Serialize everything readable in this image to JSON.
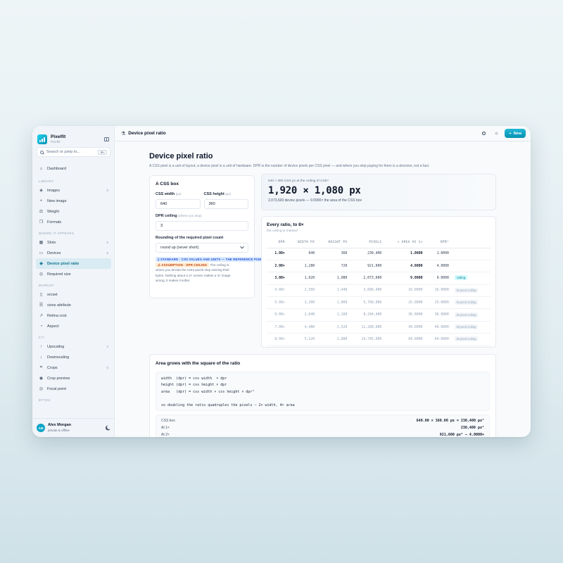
{
  "app": {
    "name": "Pixelfit",
    "subtitle": "Pixelfit"
  },
  "search": {
    "placeholder": "Search or jump to...",
    "shortcut": "⌘K"
  },
  "nav": {
    "dashboard": "Dashboard",
    "library_label": "LIBRARY",
    "library": [
      {
        "label": "Images",
        "count": "6"
      },
      {
        "label": "New image",
        "count": ""
      },
      {
        "label": "Weight",
        "count": ""
      },
      {
        "label": "Formats",
        "count": ""
      }
    ],
    "where_label": "WHERE IT APPEARS",
    "where": [
      {
        "label": "Slots",
        "count": "6"
      },
      {
        "label": "Devices",
        "count": "6"
      },
      {
        "label": "Device pixel ratio",
        "count": ""
      },
      {
        "label": "Required size",
        "count": ""
      }
    ],
    "markup_label": "MARKUP",
    "markup": [
      {
        "label": "srcset"
      },
      {
        "label": "sizes attribute"
      },
      {
        "label": "Retina cost"
      },
      {
        "label": "Aspect"
      }
    ],
    "fit_label": "FIT",
    "fit": [
      {
        "label": "Upscaling",
        "count": "2"
      },
      {
        "label": "Downscaling",
        "count": ""
      },
      {
        "label": "Crops",
        "count": "5"
      },
      {
        "label": "Crop preview",
        "count": ""
      },
      {
        "label": "Focal point",
        "count": ""
      }
    ],
    "bytes_label": "BYTES"
  },
  "user": {
    "initials": "AM",
    "name": "Alex Morgan",
    "status": "private & offline"
  },
  "topbar": {
    "title": "Device pixel ratio",
    "new_label": "New"
  },
  "page": {
    "title": "Device pixel ratio",
    "description": "A CSS pixel is a unit of layout; a device pixel is a unit of hardware. DPR is the number of device pixels per CSS pixel — and where you stop paying for them is a decision, not a fact."
  },
  "cssbox": {
    "title": "A CSS box",
    "width_label": "CSS width",
    "width_unit": "(px)",
    "width_value": "640",
    "height_label": "CSS height",
    "height_unit": "(px)",
    "height_value": "360",
    "ceiling_label": "DPR ceiling",
    "ceiling_hint": "(where you stop)",
    "ceiling_value": "3",
    "rounding_label": "Rounding of the required pixel count",
    "rounding_value": "round up (never short)",
    "tag_standard": "STANDARD · CSS VALUES AND UNITS — THE REFERENCE PIXEL",
    "tag_assumption": "ASSUMPTION · DPR CEILING",
    "note_1": "The ceiling is",
    "note_2": "where you decide the extra pixels stop earning their",
    "note_3": "bytes. Nothing about a 4× screen makes a 3× image",
    "note_4": "wrong; it makes it softer."
  },
  "result": {
    "caption": "640 × 360 CSS px at the ceiling of 3.00×",
    "value": "1,920 × 1,080 px",
    "detail": "2,073,600 device pixels — 9.0000× the area of the CSS box"
  },
  "ratios": {
    "title": "Every ratio, to 8×",
    "subtitle": "the ceiling is marked",
    "headers": [
      "DPR",
      "WIDTH PX",
      "HEIGHT PX",
      "PIXELS",
      "× AREA VS 1×",
      "DPR²"
    ],
    "rows": [
      {
        "dpr": "1.00×",
        "w": "640",
        "h": "360",
        "px": "230,400",
        "area": "1.0000",
        "sq": "1.0000",
        "note": ""
      },
      {
        "dpr": "2.00×",
        "w": "1,280",
        "h": "720",
        "px": "921,600",
        "area": "4.0000",
        "sq": "4.0000",
        "note": ""
      },
      {
        "dpr": "3.00×",
        "w": "1,920",
        "h": "1,080",
        "px": "2,073,600",
        "area": "9.0000",
        "sq": "9.0000",
        "note": "ceiling"
      },
      {
        "dpr": "4.00×",
        "w": "2,560",
        "h": "1,440",
        "px": "3,686,400",
        "area": "16.0000",
        "sq": "16.0000",
        "note": "beyond ceiling"
      },
      {
        "dpr": "5.00×",
        "w": "3,200",
        "h": "1,800",
        "px": "5,760,000",
        "area": "25.0000",
        "sq": "25.0000",
        "note": "beyond ceiling"
      },
      {
        "dpr": "6.00×",
        "w": "3,840",
        "h": "2,160",
        "px": "8,294,400",
        "area": "36.0000",
        "sq": "36.0000",
        "note": "beyond ceiling"
      },
      {
        "dpr": "7.00×",
        "w": "4,480",
        "h": "2,520",
        "px": "11,289,600",
        "area": "49.0000",
        "sq": "49.0000",
        "note": "beyond ceiling"
      },
      {
        "dpr": "8.00×",
        "w": "5,120",
        "h": "2,880",
        "px": "14,745,600",
        "area": "64.0000",
        "sq": "64.0000",
        "note": "beyond ceiling"
      }
    ]
  },
  "area": {
    "title": "Area grows with the square of the ratio",
    "code": "width  (dpr) = css width  × dpr\nheight (dpr) = css height × dpr\narea   (dpr) = css width × css height × dpr²\n\nso doubling the ratio quadruples the pixels — 2× width, 4× area",
    "calc": [
      {
        "label": "CSS box",
        "value": "640.00 × 360.00 px = 230,400 px²"
      },
      {
        "label": "At 1×",
        "value": "230,400 px²"
      },
      {
        "label": "At 2×",
        "value": "921,600 px² — 4.0000×"
      }
    ]
  }
}
